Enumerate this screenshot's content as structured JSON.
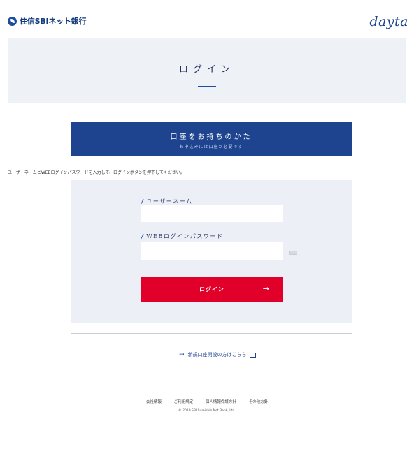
{
  "header": {
    "logo_text": "住信SBIネット銀行",
    "brand": "dayta"
  },
  "hero": {
    "title": "ログイン"
  },
  "banner": {
    "title": "口座をお持ちのかた",
    "subtitle": "- お申込みには口座が必要です -"
  },
  "instruction": "ユーザーネームとWEBログインパスワードを入力して、ログインボタンを押下してください。",
  "form": {
    "username_label": "ユーザーネーム",
    "username_value": "",
    "password_label": "WEBログインパスワード",
    "password_value": "",
    "login_button": "ログイン",
    "login_arrow": "→"
  },
  "open_account_link": {
    "arrow": "→",
    "label": "新規口座開設の方はこちら"
  },
  "footer": {
    "links": [
      "会社情報",
      "ご利用規定",
      "個人情報保護方針",
      "その他方針"
    ],
    "copyright": "© 2019 SBI Sumishin Net Bank, Ltd."
  },
  "colors": {
    "brand_blue": "#1e4490",
    "login_red": "#e0002a",
    "panel_gray": "#eceff5"
  }
}
